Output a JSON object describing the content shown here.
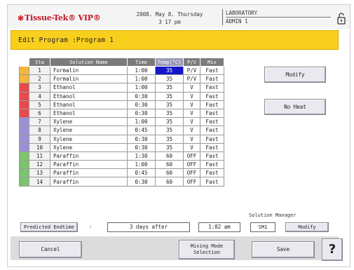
{
  "header": {
    "logo_mark": "✱",
    "logo_text": "Tissue-Tek® VIP®",
    "date_line": "2008. May 8. Thursday",
    "time_line": "3 17 pm",
    "location": "LABORATORY",
    "user": "ADMIN 1",
    "lock_icon": "lock-icon"
  },
  "title": "Edit Program :Program 1",
  "table": {
    "headers": [
      "Sta",
      "Solution Name",
      "Time",
      "Temp(°C)",
      "P/V",
      "Mix"
    ],
    "rows": [
      {
        "sta": "1",
        "name": "Formalin",
        "time": "1:00",
        "temp": "35",
        "pv": "P/V",
        "mix": "Fast",
        "color": "#f4b63b"
      },
      {
        "sta": "2",
        "name": "Formalin",
        "time": "1:00",
        "temp": "35",
        "pv": "P/V",
        "mix": "Fast",
        "color": "#f4b63b"
      },
      {
        "sta": "3",
        "name": "Ethanol",
        "time": "1:00",
        "temp": "35",
        "pv": "V",
        "mix": "Fast",
        "color": "#e84a4e"
      },
      {
        "sta": "4",
        "name": "Ethanol",
        "time": "0:30",
        "temp": "35",
        "pv": "V",
        "mix": "Fast",
        "color": "#e84a4e"
      },
      {
        "sta": "5",
        "name": "Ethanol",
        "time": "0:30",
        "temp": "35",
        "pv": "V",
        "mix": "Fast",
        "color": "#e84a4e"
      },
      {
        "sta": "6",
        "name": "Ethanol",
        "time": "0:30",
        "temp": "35",
        "pv": "V",
        "mix": "Fast",
        "color": "#e84a4e"
      },
      {
        "sta": "7",
        "name": "Xylene",
        "time": "1:00",
        "temp": "35",
        "pv": "V",
        "mix": "Fast",
        "color": "#9b8fd4"
      },
      {
        "sta": "8",
        "name": "Xylene",
        "time": "0:45",
        "temp": "35",
        "pv": "V",
        "mix": "Fast",
        "color": "#9b8fd4"
      },
      {
        "sta": "9",
        "name": "Xylene",
        "time": "0:30",
        "temp": "35",
        "pv": "V",
        "mix": "Fast",
        "color": "#9b8fd4"
      },
      {
        "sta": "10",
        "name": "Xylene",
        "time": "0:30",
        "temp": "35",
        "pv": "V",
        "mix": "Fast",
        "color": "#9b8fd4"
      },
      {
        "sta": "11",
        "name": "Paraffin",
        "time": "1:30",
        "temp": "60",
        "pv": "OFF",
        "mix": "Fast",
        "color": "#7dc46f"
      },
      {
        "sta": "12",
        "name": "Paraffin",
        "time": "1:00",
        "temp": "60",
        "pv": "OFF",
        "mix": "Fast",
        "color": "#7dc46f"
      },
      {
        "sta": "13",
        "name": "Paraffin",
        "time": "0:45",
        "temp": "60",
        "pv": "OFF",
        "mix": "Fast",
        "color": "#7dc46f"
      },
      {
        "sta": "14",
        "name": "Paraffin",
        "time": "0:30",
        "temp": "60",
        "pv": "OFF",
        "mix": "Fast",
        "color": "#7dc46f"
      }
    ],
    "selected": {
      "row": 0,
      "column": "temp",
      "color": "#1416c8"
    }
  },
  "buttons": {
    "modify": "Modify",
    "no_heat": "No Heat",
    "predicted_endtime": "Predicted Endtime",
    "solution_manager_modify": "Modify",
    "cancel": "Cancel",
    "mixing_mode": "Mixing Mode\nSelection",
    "save": "Save",
    "help": "?"
  },
  "endtime": {
    "colon": ":",
    "days": "3 days after",
    "time": "1:02 am"
  },
  "solution_manager": {
    "label": "Solution Manager",
    "value": "SM1"
  },
  "colors": {
    "title_bar": "#f9cf1e",
    "logo": "#d51d2a",
    "table_header": "#7b7b7b"
  }
}
